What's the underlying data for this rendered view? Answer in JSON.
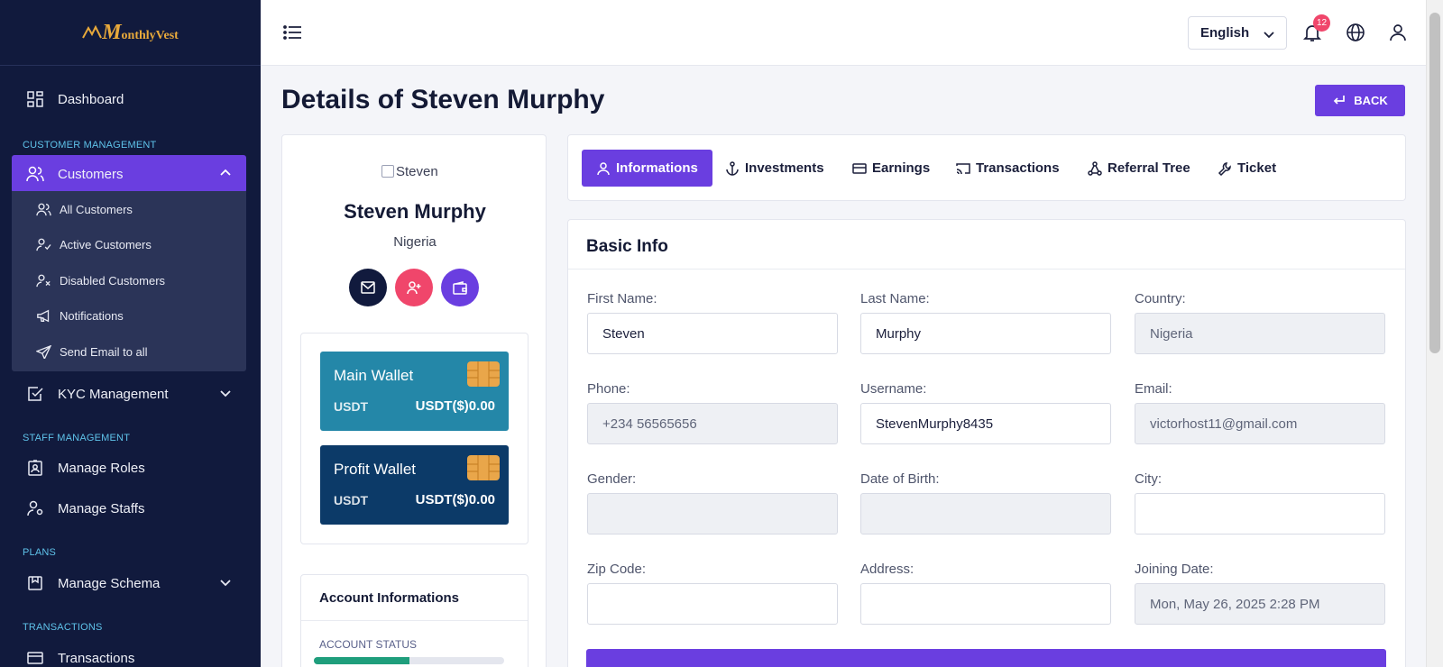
{
  "app": {
    "logo": "MonthlyVest",
    "logo_initial": "M",
    "logo_rest": "onthlyVest"
  },
  "sidebar": {
    "dashboard": "Dashboard",
    "section_customer": "CUSTOMER MANAGEMENT",
    "customers": "Customers",
    "sub": {
      "all": "All Customers",
      "active": "Active Customers",
      "disabled": "Disabled Customers",
      "notifications": "Notifications",
      "send_email": "Send Email to all"
    },
    "kyc": "KYC Management",
    "section_staff": "STAFF MANAGEMENT",
    "roles": "Manage Roles",
    "staffs": "Manage Staffs",
    "section_plans": "PLANS",
    "schema": "Manage Schema",
    "section_transactions": "TRANSACTIONS",
    "transactions": "Transactions"
  },
  "header": {
    "language": "English",
    "notification_count": "12"
  },
  "page": {
    "title": "Details of Steven Murphy",
    "back": "BACK"
  },
  "profile": {
    "avatar_alt": "Steven",
    "name": "Steven Murphy",
    "country": "Nigeria"
  },
  "wallets": {
    "main": {
      "title": "Main Wallet",
      "currency": "USDT",
      "amount": "USDT($)0.00",
      "color": "#2487a8"
    },
    "profit": {
      "title": "Profit Wallet",
      "currency": "USDT",
      "amount": "USDT($)0.00",
      "color": "#0c3a68"
    }
  },
  "account": {
    "title": "Account Informations",
    "status_label": "ACCOUNT STATUS",
    "status_progress": 0.5
  },
  "tabs": {
    "informations": "Informations",
    "investments": "Investments",
    "earnings": "Earnings",
    "transactions": "Transactions",
    "referral": "Referral Tree",
    "ticket": "Ticket"
  },
  "basic_info": {
    "title": "Basic Info",
    "first_name_label": "First Name:",
    "first_name": "Steven",
    "last_name_label": "Last Name:",
    "last_name": "Murphy",
    "country_label": "Country:",
    "country": "Nigeria",
    "phone_label": "Phone:",
    "phone": "+234 56565656",
    "username_label": "Username:",
    "username": "StevenMurphy8435",
    "email_label": "Email:",
    "email": "victorhost11@gmail.com",
    "gender_label": "Gender:",
    "gender": "",
    "dob_label": "Date of Birth:",
    "dob": "",
    "city_label": "City:",
    "city": "",
    "zip_label": "Zip Code:",
    "zip": "",
    "address_label": "Address:",
    "address": "",
    "joining_label": "Joining Date:",
    "joining": "Mon, May 26, 2025 2:28 PM"
  },
  "colors": {
    "accent": "#6a3ee0",
    "sidebar_bg": "#111a3d",
    "section_title": "#5fc3ea",
    "badge": "#f0466b",
    "mail_btn": "#111a3d",
    "add_user_btn": "#f0466b",
    "wallet_btn": "#6a3ee0"
  }
}
